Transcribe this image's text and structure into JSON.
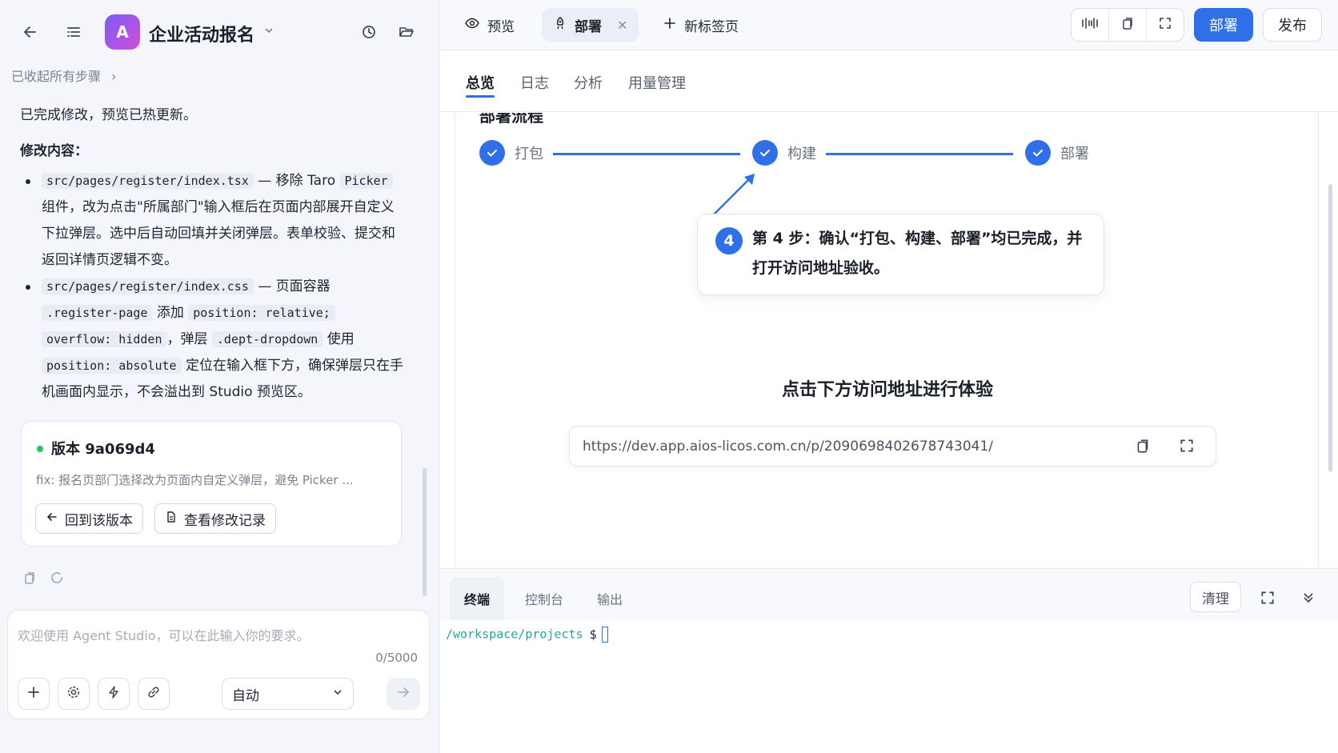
{
  "app": {
    "avatar_letter": "A",
    "title": "企业活动报名"
  },
  "left": {
    "collapsed_label": "已收起所有步骤",
    "message": {
      "intro": "已完成修改，预览已热更新。",
      "heading": "修改内容：",
      "item1": {
        "path": "src/pages/register/index.tsx",
        "t1": " — 移除 Taro ",
        "code_picker": "Picker",
        "t2": " 组件，改为点击\"所属部门\"输入框后在页面内部展开自定义下拉弹层。选中后自动回填并关闭弹层。表单校验、提交和返回详情页逻辑不变。"
      },
      "item2": {
        "path": "src/pages/register/index.css",
        "t1": " — 页面容器 ",
        "c_page": ".register-page",
        "t2": " 添加 ",
        "c_pos": "position: relative;",
        "c_overflow": "overflow: hidden",
        "t3": "，弹层 ",
        "c_dropdown": ".dept-dropdown",
        "t4": " 使用 ",
        "c_abs": "position: absolute",
        "t5": " 定位在输入框下方，确保弹层只在手机画面内显示，不会溢出到 Studio 预览区。"
      }
    },
    "version": {
      "title": "版本 9a069d4",
      "desc": "fix: 报名页部门选择改为页面内自定义弹层，避免 Picker ...",
      "revert_label": "回到该版本",
      "history_label": "查看修改记录"
    },
    "input": {
      "placeholder": "欢迎使用 Agent Studio，可以在此输入你的要求。",
      "counter": "0/5000",
      "mode": "自动"
    }
  },
  "right": {
    "tabs": {
      "preview": "预览",
      "deploy": "部署",
      "new_tab": "新标签页"
    },
    "deploy_button": "部署",
    "publish_button": "发布",
    "subtabs": [
      "总览",
      "日志",
      "分析",
      "用量管理"
    ],
    "steps": [
      "打包",
      "构建",
      "部署"
    ],
    "callout": {
      "number": "4",
      "text": "第 4 步：确认“打包、构建、部署”均已完成，并打开访问地址验收。"
    },
    "visit_title": "点击下方访问地址进行体验",
    "url": "https://dev.app.aios-licos.com.cn/p/2090698402678743041/",
    "terminal": {
      "tabs": [
        "终端",
        "控制台",
        "输出"
      ],
      "clear": "清理",
      "path": "/workspace/projects",
      "symbol": "$"
    }
  },
  "colors": {
    "accent": "#2f6fe8",
    "success": "#22c55e",
    "terminal_path": "#2aa3a0"
  }
}
